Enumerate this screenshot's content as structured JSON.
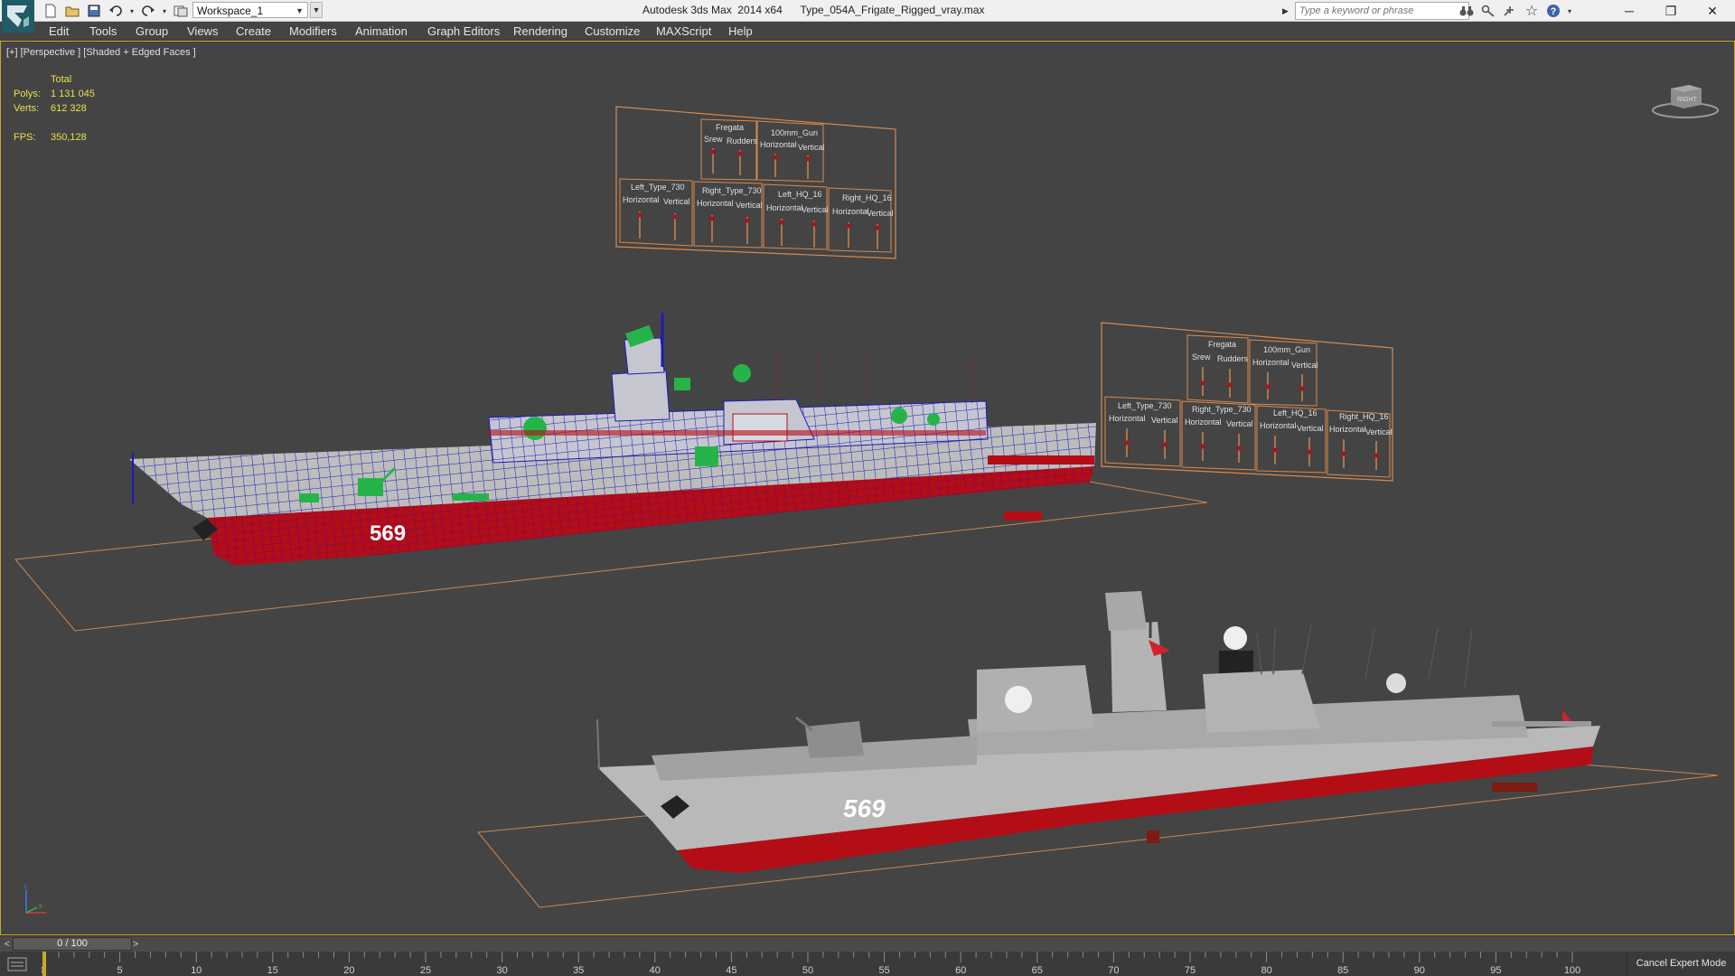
{
  "app": {
    "title": "Autodesk 3ds Max  2014 x64      Type_054A_Frigate_Rigged_vray.max",
    "workspace": "Workspace_1",
    "search_placeholder": "Type a keyword or phrase"
  },
  "menu": [
    "Edit",
    "Tools",
    "Group",
    "Views",
    "Create",
    "Modifiers",
    "Animation",
    "Graph Editors",
    "Rendering",
    "Customize",
    "MAXScript",
    "Help"
  ],
  "viewport": {
    "label": "[+] [Perspective ] [Shaded + Edged Faces ]",
    "stats": {
      "total_label": "Total",
      "polys_label": "Polys:",
      "polys_value": "1 131 045",
      "verts_label": "Verts:",
      "verts_value": "612 328",
      "fps_label": "FPS:",
      "fps_value": "350,128"
    }
  },
  "rig_panel": {
    "top_sections": [
      {
        "name": "Fregata",
        "left": "Srew",
        "right": "Rudders"
      },
      {
        "name": "100mm_Gun",
        "left": "Horizontal",
        "right": "Vertical"
      }
    ],
    "bottom_sections": [
      {
        "name": "Left_Type_730",
        "left": "Horizontal",
        "right": "Vertical"
      },
      {
        "name": "Right_Type_730",
        "left": "Horizontal",
        "right": "Vertical"
      },
      {
        "name": "Left_HQ_16",
        "left": "Horizontal",
        "right": "Vertical"
      },
      {
        "name": "Right_HQ_16",
        "left": "Horizontal",
        "right": "Vertical"
      }
    ]
  },
  "ship": {
    "hull_number": "569"
  },
  "viewcube": {
    "label": "RIGHT"
  },
  "timeline": {
    "slider_value": "0 / 100",
    "ticks": [
      0,
      5,
      10,
      15,
      20,
      25,
      30,
      35,
      40,
      45,
      50,
      55,
      60,
      65,
      70,
      75,
      80,
      85,
      90,
      95,
      100
    ],
    "cancel_expert": "Cancel Expert Mode"
  },
  "colors": {
    "viewport_bg": "#444444",
    "wire_blue": "#1c1cb4",
    "hull_red": "#b30d16",
    "hull_grey": "#b9b9b9",
    "helper_green": "#26b44a",
    "rig_orange": "#d88a4e",
    "stats_yellow": "#e6e14c"
  }
}
